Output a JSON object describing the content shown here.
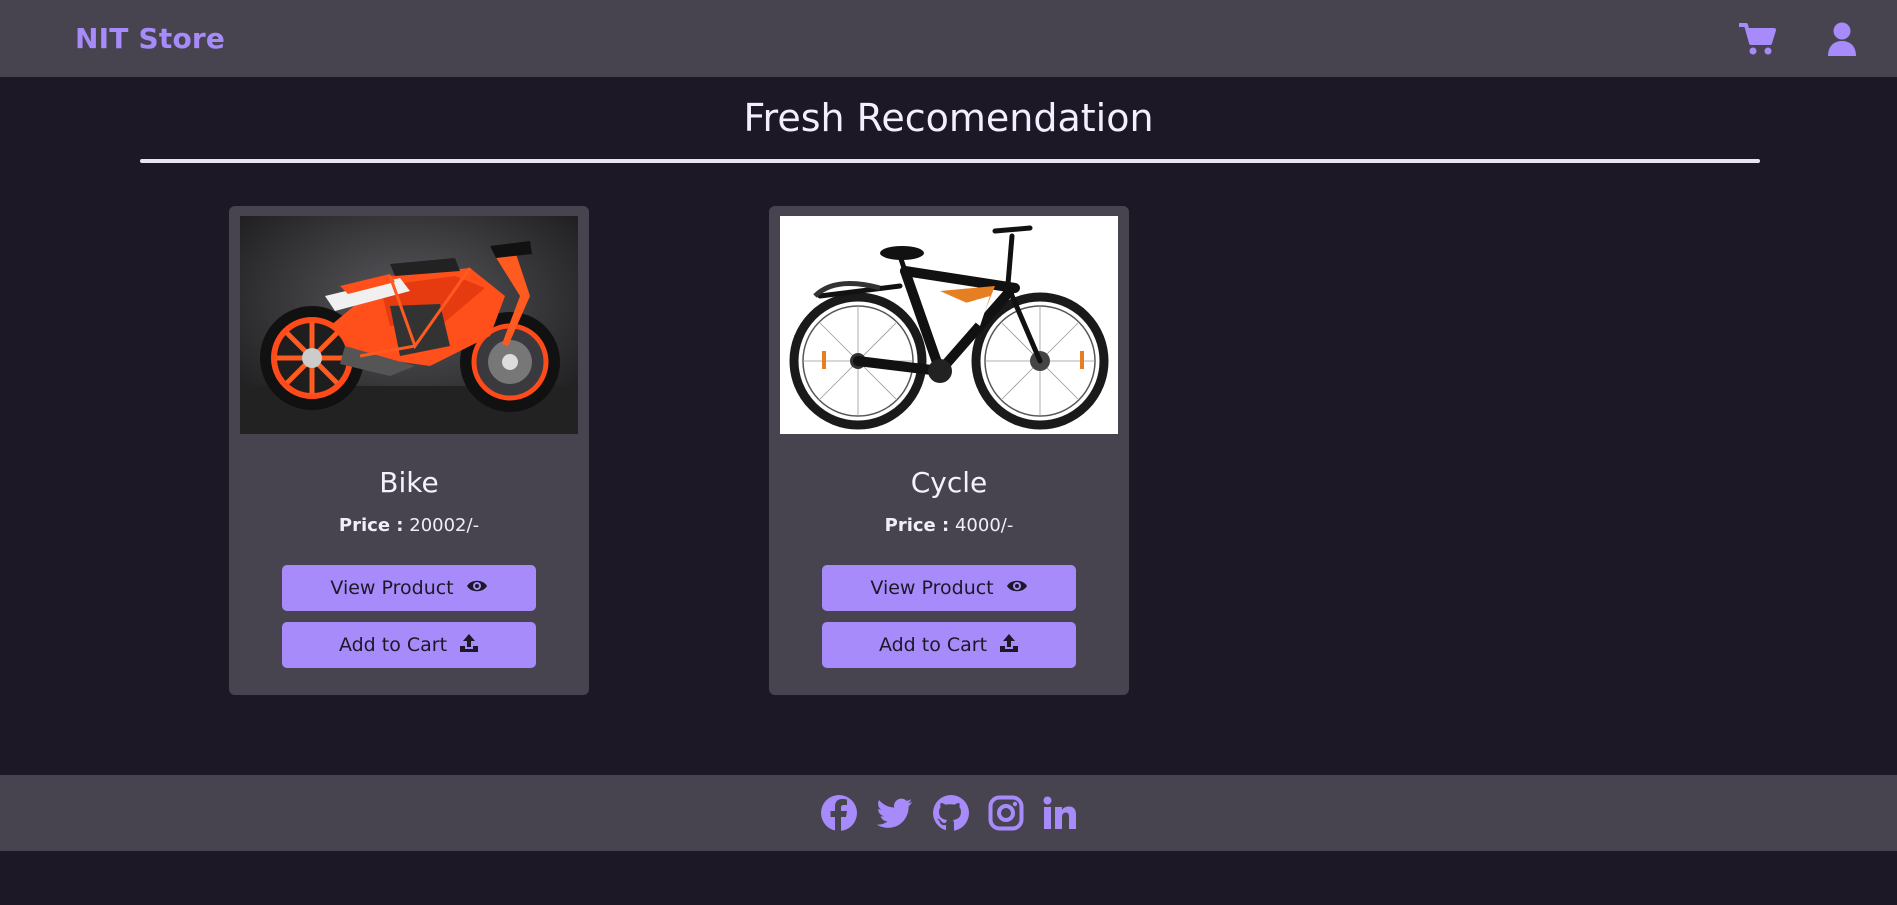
{
  "navbar": {
    "brand": "NIT Store",
    "icons": [
      "cart-icon",
      "user-icon"
    ]
  },
  "section": {
    "title": "Fresh Recomendation"
  },
  "products": [
    {
      "name": "Bike",
      "price_label": "Price :",
      "price_value": "20002/-",
      "view_label": "View Product",
      "cart_label": "Add to Cart",
      "image": "motorcycle-photo"
    },
    {
      "name": "Cycle",
      "price_label": "Price :",
      "price_value": "4000/-",
      "view_label": "View Product",
      "cart_label": "Add to Cart",
      "image": "bicycle-photo"
    }
  ],
  "footer": {
    "icons": [
      "facebook-icon",
      "twitter-icon",
      "github-icon",
      "instagram-icon",
      "linkedin-icon"
    ]
  },
  "colors": {
    "background": "#1c1826",
    "surface": "#48444f",
    "accent": "#a78bfa",
    "text": "#ece9f5"
  }
}
